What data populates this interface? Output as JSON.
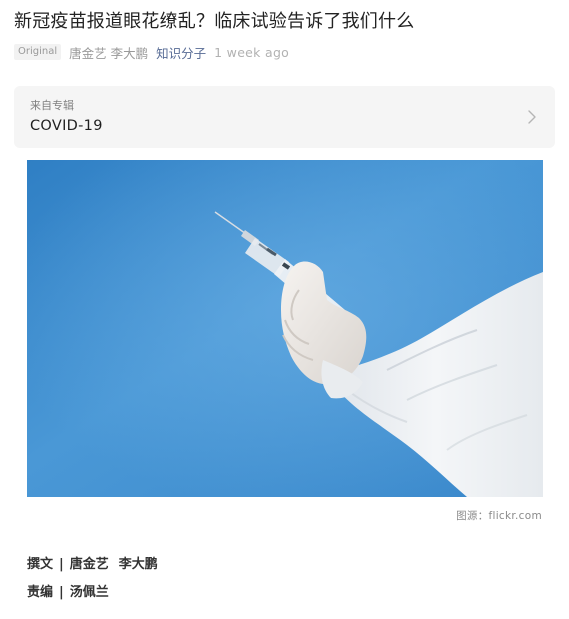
{
  "article": {
    "title": "新冠疫苗报道眼花缭乱？临床试验告诉了我们什么",
    "tag": "Original",
    "authors": "唐金艺 李大鹏",
    "account": "知识分子",
    "time": "1 week ago"
  },
  "album": {
    "label": "来自专辑",
    "name": "COVID-19"
  },
  "image": {
    "credit": "图源：flickr.com"
  },
  "byline": {
    "writers_label": "撰文",
    "writer_1": "唐金艺",
    "writer_2": "李大鹏",
    "editor_label": "责编",
    "editor_name": "汤佩兰",
    "separator": "|"
  },
  "colors": {
    "account_link": "#576b95",
    "photo_background": "#3f8fd0"
  },
  "icons": {
    "album_chevron": "chevron-right-icon"
  }
}
